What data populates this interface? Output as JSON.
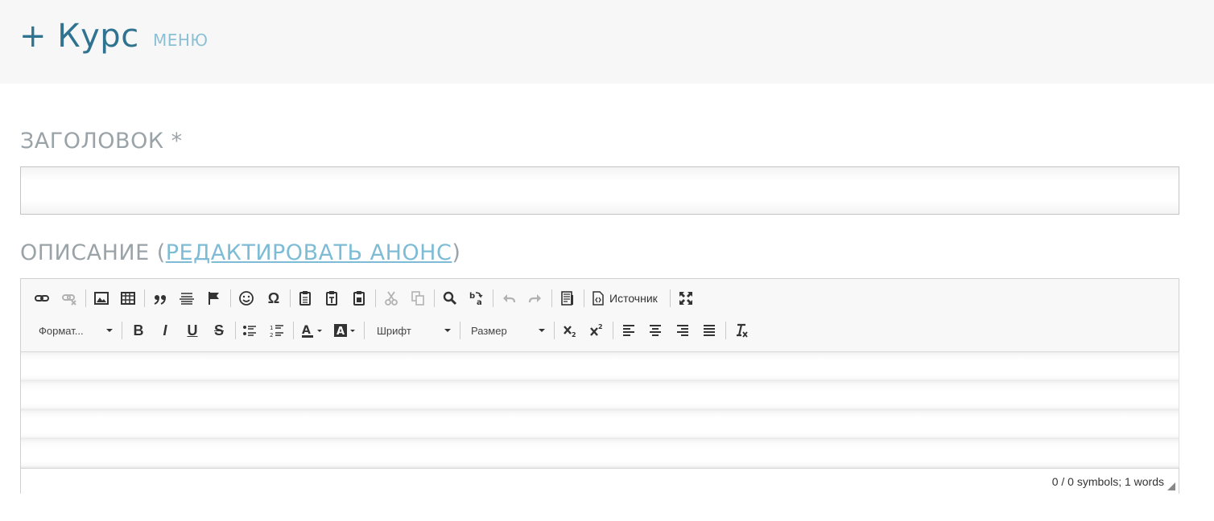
{
  "header": {
    "title": "+ Курс",
    "menu_label": "МЕНЮ"
  },
  "form": {
    "title_label": "ЗАГОЛОВОК *",
    "title_value": "",
    "description_label_prefix": "ОПИСАНИЕ (",
    "description_link": "РЕДАКТИРОВАТЬ АНОНС",
    "description_label_suffix": ")"
  },
  "editor": {
    "toolbar_row1": [
      {
        "icon": "link-icon"
      },
      {
        "icon": "unlink-icon",
        "disabled": true
      },
      {
        "icon": "image-icon"
      },
      {
        "icon": "table-icon"
      },
      {
        "icon": "blockquote-icon"
      },
      {
        "icon": "horizontal-rule-icon"
      },
      {
        "icon": "anchor-flag-icon"
      },
      {
        "icon": "smiley-icon"
      },
      {
        "icon": "special-char-icon",
        "glyph": "Ω"
      },
      {
        "icon": "paste-icon"
      },
      {
        "icon": "paste-text-icon"
      },
      {
        "icon": "paste-word-icon"
      },
      {
        "icon": "cut-icon",
        "disabled": true
      },
      {
        "icon": "copy-icon",
        "disabled": true
      },
      {
        "icon": "find-icon"
      },
      {
        "icon": "replace-icon"
      },
      {
        "icon": "undo-icon",
        "disabled": true
      },
      {
        "icon": "redo-icon",
        "disabled": true
      },
      {
        "icon": "template-icon"
      }
    ],
    "source_label": "Источник",
    "format_label": "Формат...",
    "font_label": "Шрифт",
    "size_label": "Размер",
    "status_text": "0 / 0 symbols; 1 words"
  }
}
